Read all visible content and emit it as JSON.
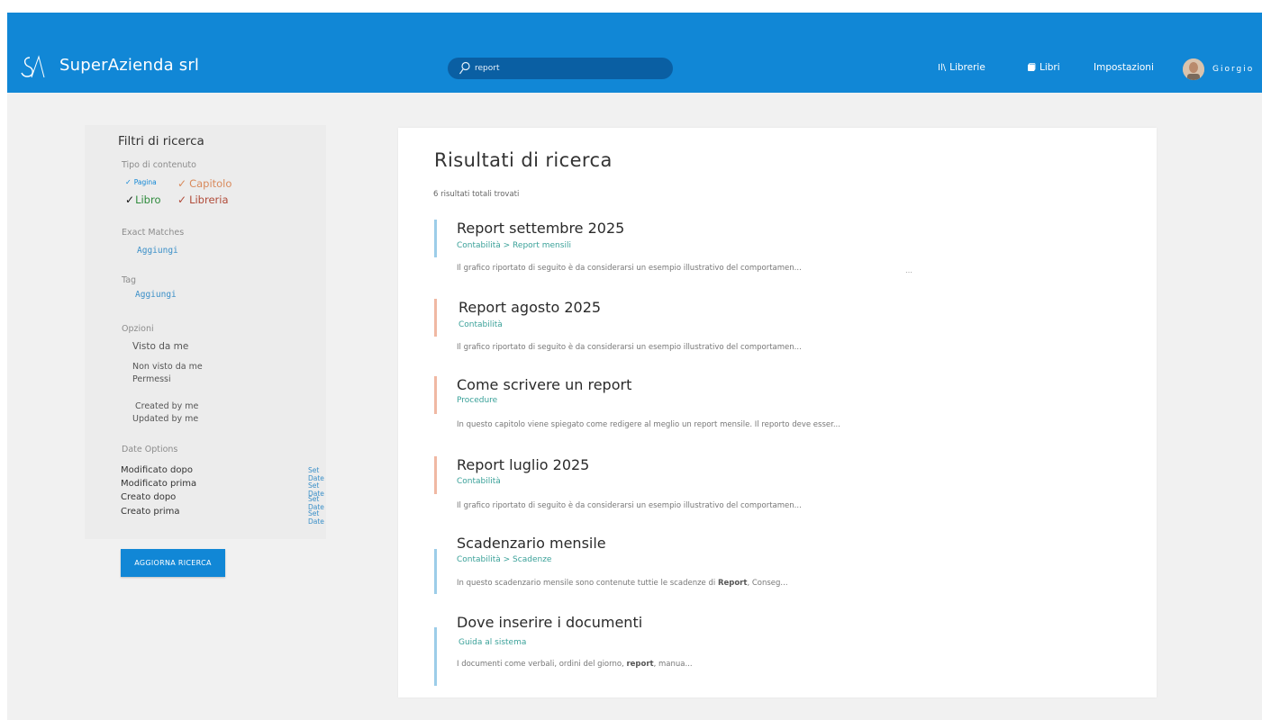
{
  "colors": {
    "accent": "#1187d6",
    "breadcrumb": "#3aa199",
    "bar_blue": "#9ccde9",
    "bar_salmon": "#f0b8a3",
    "link": "#3a8fc8"
  },
  "header": {
    "brand": "SuperAzienda srl",
    "search": {
      "value": "report"
    },
    "nav": [
      {
        "label": "Librerie",
        "icon": "library-icon"
      },
      {
        "label": "Libri",
        "icon": "book-icon"
      },
      {
        "label": "Impostazioni",
        "icon": ""
      }
    ],
    "user": {
      "name": "Giorgio"
    }
  },
  "filters": {
    "title": "Filtri di ricerca",
    "content_type": {
      "label": "Tipo di contenuto",
      "options": [
        {
          "label": "Pagina",
          "color": "#1187d6"
        },
        {
          "label": "Capitolo",
          "color": "#d98a5c"
        },
        {
          "label": "Libro",
          "color": "#2e8b3c"
        },
        {
          "label": "Libreria",
          "color": "#b04a38"
        }
      ],
      "tick": "✓"
    },
    "exact_matches": {
      "label": "Exact Matches",
      "add": "Aggiungi"
    },
    "tag": {
      "label": "Tag",
      "add": "Aggiungi"
    },
    "options": {
      "label": "Opzioni",
      "items": [
        "Visto da me",
        "Non visto da me",
        "Permessi",
        "Created by me",
        "Updated by me"
      ]
    },
    "date_options": {
      "label": "Date Options",
      "rows": [
        {
          "label": "Modificato dopo",
          "action": "Set Date"
        },
        {
          "label": "Modificato prima",
          "action": "Set Date"
        },
        {
          "label": "Creato dopo",
          "action": "Set Date"
        },
        {
          "label": "Creato prima",
          "action": "Set Date"
        }
      ]
    },
    "update_button": "AGGIORNA RICERCA"
  },
  "results": {
    "title": "Risultati di ricerca",
    "count": "6 risultati totali trovati",
    "items": [
      {
        "title": "Report settembre 2025",
        "breadcrumb": "Contabilità > Report mensili",
        "excerpt": "Il grafico riportato di seguito è da considerarsi un esempio illustrativo del comportamen...",
        "bar": "blue"
      },
      {
        "title": "Report agosto 2025",
        "breadcrumb": "Contabilità",
        "excerpt": "Il grafico riportato di seguito è da considerarsi un esempio illustrativo del comportamen...",
        "bar": "salmon"
      },
      {
        "title": "Come scrivere un report",
        "breadcrumb": "Procedure",
        "excerpt": "In questo capitolo viene spiegato come redigere al meglio un report mensile. Il reporto deve esser...",
        "bar": "salmon"
      },
      {
        "title": "Report luglio 2025",
        "breadcrumb": "Contabilità",
        "excerpt": "Il grafico riportato di seguito è da considerarsi un esempio illustrativo del comportamen...",
        "bar": "salmon"
      },
      {
        "title": "Scadenzario mensile",
        "breadcrumb": "Contabilità > Scadenze",
        "excerpt_pre": "In questo scadenzario mensile sono contenute tuttie le  scadenze di ",
        "excerpt_bold": "Report",
        "excerpt_post": ", Conseg...",
        "bar": "blue"
      },
      {
        "title": "Dove inserire i documenti",
        "breadcrumb": "Guida al sistema",
        "excerpt_pre": "I documenti come verbali, ordini del giorno, ",
        "excerpt_bold": "report",
        "excerpt_post": ", manua...",
        "bar": "blue"
      }
    ]
  }
}
